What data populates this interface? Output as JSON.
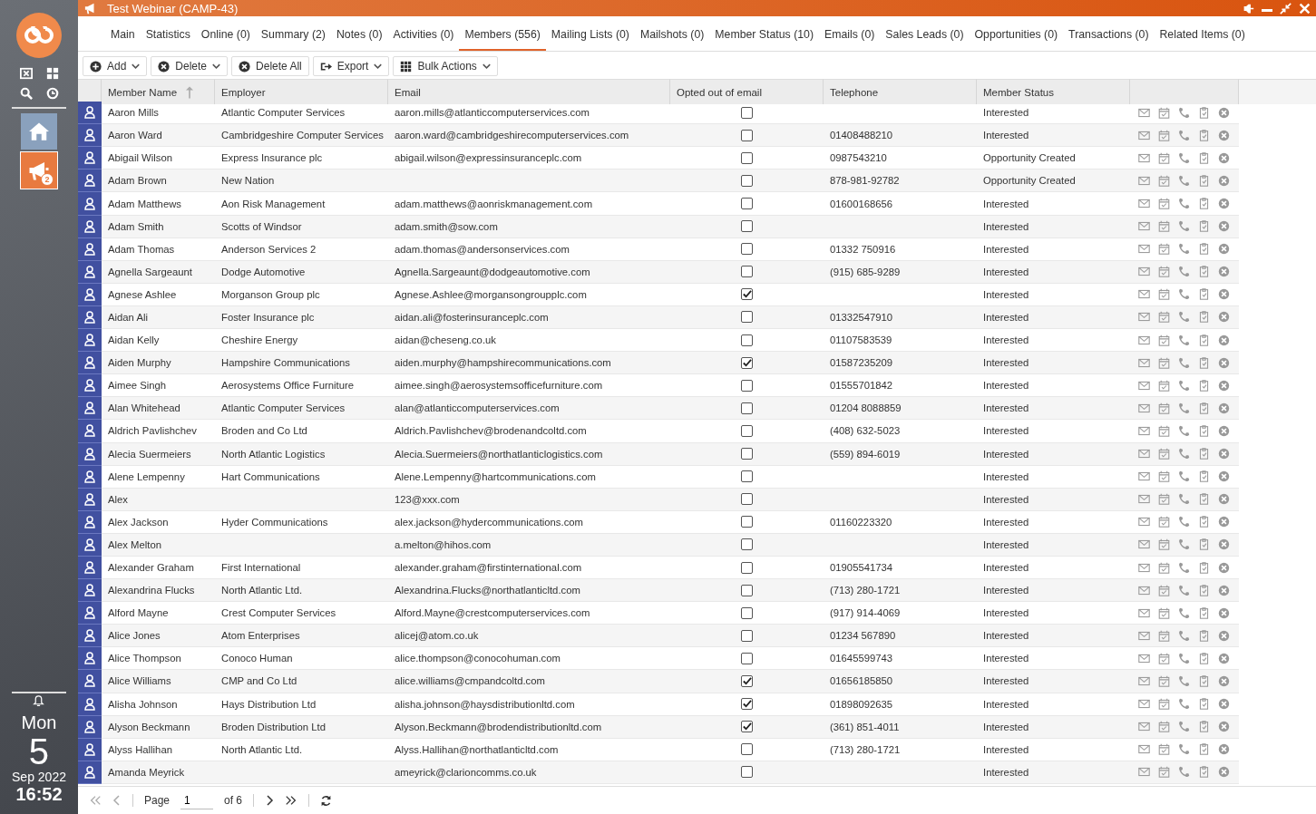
{
  "window": {
    "title": "Test Webinar (CAMP-43)"
  },
  "sidebar": {
    "items": [
      {
        "kind": "home",
        "selected": false
      },
      {
        "kind": "campaign",
        "selected": true,
        "badge": "2"
      }
    ],
    "clock": {
      "day": "Mon",
      "date": "5",
      "month_year": "Sep 2022",
      "time": "16:52"
    }
  },
  "tabs": [
    {
      "label": "Main",
      "selected": false
    },
    {
      "label": "Statistics",
      "selected": false
    },
    {
      "label": "Online (0)",
      "selected": false
    },
    {
      "label": "Summary (2)",
      "selected": false
    },
    {
      "label": "Notes (0)",
      "selected": false
    },
    {
      "label": "Activities (0)",
      "selected": false
    },
    {
      "label": "Members (556)",
      "selected": true
    },
    {
      "label": "Mailing Lists (0)",
      "selected": false
    },
    {
      "label": "Mailshots (0)",
      "selected": false
    },
    {
      "label": "Member Status (10)",
      "selected": false
    },
    {
      "label": "Emails (0)",
      "selected": false
    },
    {
      "label": "Sales Leads (0)",
      "selected": false
    },
    {
      "label": "Opportunities (0)",
      "selected": false
    },
    {
      "label": "Transactions (0)",
      "selected": false
    },
    {
      "label": "Related Items (0)",
      "selected": false
    }
  ],
  "toolbar": [
    {
      "kind": "add",
      "label": "Add",
      "dropdown": true
    },
    {
      "kind": "delete",
      "label": "Delete",
      "dropdown": true
    },
    {
      "kind": "delete",
      "label": "Delete All",
      "dropdown": false
    },
    {
      "kind": "export",
      "label": "Export",
      "dropdown": true
    },
    {
      "kind": "grid",
      "label": "Bulk Actions",
      "dropdown": true
    }
  ],
  "table": {
    "columns": [
      {
        "label": "Member Name",
        "sorted": true
      },
      {
        "label": "Employer",
        "sorted": false
      },
      {
        "label": "Email",
        "sorted": false
      },
      {
        "label": "Opted out of email",
        "sorted": false
      },
      {
        "label": "Telephone",
        "sorted": false
      },
      {
        "label": "Member Status",
        "sorted": false
      }
    ],
    "rows": [
      {
        "name": "Aaron Mills",
        "employer": "Atlantic Computer Services",
        "email": "aaron.mills@atlanticcomputerservices.com",
        "opted_out": false,
        "telephone": "",
        "status": "Interested"
      },
      {
        "name": "Aaron Ward",
        "employer": "Cambridgeshire Computer Services",
        "email": "aaron.ward@cambridgeshirecomputerservices.com",
        "opted_out": false,
        "telephone": "01408488210",
        "status": "Interested"
      },
      {
        "name": "Abigail Wilson",
        "employer": "Express Insurance plc",
        "email": "abigail.wilson@expressinsuranceplc.com",
        "opted_out": false,
        "telephone": "0987543210",
        "status": "Opportunity Created"
      },
      {
        "name": "Adam Brown",
        "employer": "New Nation",
        "email": "",
        "opted_out": false,
        "telephone": "878-981-92782",
        "status": "Opportunity Created"
      },
      {
        "name": "Adam Matthews",
        "employer": "Aon Risk Management",
        "email": "adam.matthews@aonriskmanagement.com",
        "opted_out": false,
        "telephone": "01600168656",
        "status": "Interested"
      },
      {
        "name": "Adam Smith",
        "employer": "Scotts of Windsor",
        "email": "adam.smith@sow.com",
        "opted_out": false,
        "telephone": "",
        "status": "Interested"
      },
      {
        "name": "Adam Thomas",
        "employer": "Anderson Services 2",
        "email": "adam.thomas@andersonservices.com",
        "opted_out": false,
        "telephone": "01332 750916",
        "status": "Interested"
      },
      {
        "name": "Agnella Sargeaunt",
        "employer": "Dodge Automotive",
        "email": "Agnella.Sargeaunt@dodgeautomotive.com",
        "opted_out": false,
        "telephone": "(915) 685-9289",
        "status": "Interested"
      },
      {
        "name": "Agnese Ashlee",
        "employer": "Morganson Group plc",
        "email": "Agnese.Ashlee@morgansongroupplc.com",
        "opted_out": true,
        "telephone": "",
        "status": "Interested"
      },
      {
        "name": "Aidan Ali",
        "employer": "Foster Insurance plc",
        "email": "aidan.ali@fosterinsuranceplc.com",
        "opted_out": false,
        "telephone": "01332547910",
        "status": "Interested"
      },
      {
        "name": "Aidan Kelly",
        "employer": "Cheshire Energy",
        "email": "aidan@cheseng.co.uk",
        "opted_out": false,
        "telephone": "01107583539",
        "status": "Interested"
      },
      {
        "name": "Aiden Murphy",
        "employer": "Hampshire Communications",
        "email": "aiden.murphy@hampshirecommunications.com",
        "opted_out": true,
        "telephone": "01587235209",
        "status": "Interested"
      },
      {
        "name": "Aimee Singh",
        "employer": "Aerosystems Office Furniture",
        "email": "aimee.singh@aerosystemsofficefurniture.com",
        "opted_out": false,
        "telephone": "01555701842",
        "status": "Interested"
      },
      {
        "name": "Alan Whitehead",
        "employer": "Atlantic Computer Services",
        "email": "alan@atlanticcomputerservices.com",
        "opted_out": false,
        "telephone": "01204 8088859",
        "status": "Interested"
      },
      {
        "name": "Aldrich Pavlishchev",
        "employer": "Broden and Co Ltd",
        "email": "Aldrich.Pavlishchev@brodenandcoltd.com",
        "opted_out": false,
        "telephone": "(408) 632-5023",
        "status": "Interested"
      },
      {
        "name": "Alecia Suermeiers",
        "employer": "North Atlantic Logistics",
        "email": "Alecia.Suermeiers@northatlanticlogistics.com",
        "opted_out": false,
        "telephone": "(559) 894-6019",
        "status": "Interested"
      },
      {
        "name": "Alene Lempenny",
        "employer": "Hart Communications",
        "email": "Alene.Lempenny@hartcommunications.com",
        "opted_out": false,
        "telephone": "",
        "status": "Interested"
      },
      {
        "name": "Alex",
        "employer": "",
        "email": "123@xxx.com",
        "opted_out": false,
        "telephone": "",
        "status": "Interested"
      },
      {
        "name": "Alex Jackson",
        "employer": "Hyder Communications",
        "email": "alex.jackson@hydercommunications.com",
        "opted_out": false,
        "telephone": "01160223320",
        "status": "Interested"
      },
      {
        "name": "Alex Melton",
        "employer": "",
        "email": "a.melton@hihos.com",
        "opted_out": false,
        "telephone": "",
        "status": "Interested"
      },
      {
        "name": "Alexander Graham",
        "employer": "First International",
        "email": "alexander.graham@firstinternational.com",
        "opted_out": false,
        "telephone": "01905541734",
        "status": "Interested"
      },
      {
        "name": "Alexandrina Flucks",
        "employer": "North Atlantic Ltd.",
        "email": "Alexandrina.Flucks@northatlanticltd.com",
        "opted_out": false,
        "telephone": "(713) 280-1721",
        "status": "Interested"
      },
      {
        "name": "Alford Mayne",
        "employer": "Crest Computer Services",
        "email": "Alford.Mayne@crestcomputerservices.com",
        "opted_out": false,
        "telephone": "(917) 914-4069",
        "status": "Interested"
      },
      {
        "name": "Alice Jones",
        "employer": "Atom Enterprises",
        "email": "alicej@atom.co.uk",
        "opted_out": false,
        "telephone": "01234 567890",
        "status": "Interested"
      },
      {
        "name": "Alice Thompson",
        "employer": "Conoco Human",
        "email": "alice.thompson@conocohuman.com",
        "opted_out": false,
        "telephone": "01645599743",
        "status": "Interested"
      },
      {
        "name": "Alice Williams",
        "employer": "CMP and Co Ltd",
        "email": "alice.williams@cmpandcoltd.com",
        "opted_out": true,
        "telephone": "01656185850",
        "status": "Interested"
      },
      {
        "name": "Alisha Johnson",
        "employer": "Hays Distribution Ltd",
        "email": "alisha.johnson@haysdistributionltd.com",
        "opted_out": true,
        "telephone": "01898092635",
        "status": "Interested"
      },
      {
        "name": "Alyson Beckmann",
        "employer": "Broden Distribution Ltd",
        "email": "Alyson.Beckmann@brodendistributionltd.com",
        "opted_out": true,
        "telephone": "(361) 851-4011",
        "status": "Interested"
      },
      {
        "name": "Alyss Hallihan",
        "employer": "North Atlantic Ltd.",
        "email": "Alyss.Hallihan@northatlanticltd.com",
        "opted_out": false,
        "telephone": "(713) 280-1721",
        "status": "Interested"
      },
      {
        "name": "Amanda Meyrick",
        "employer": "",
        "email": "ameyrick@clarioncomms.co.uk",
        "opted_out": false,
        "telephone": "",
        "status": "Interested"
      }
    ]
  },
  "pager": {
    "label": "Page",
    "page": "1",
    "of": "of 6"
  }
}
